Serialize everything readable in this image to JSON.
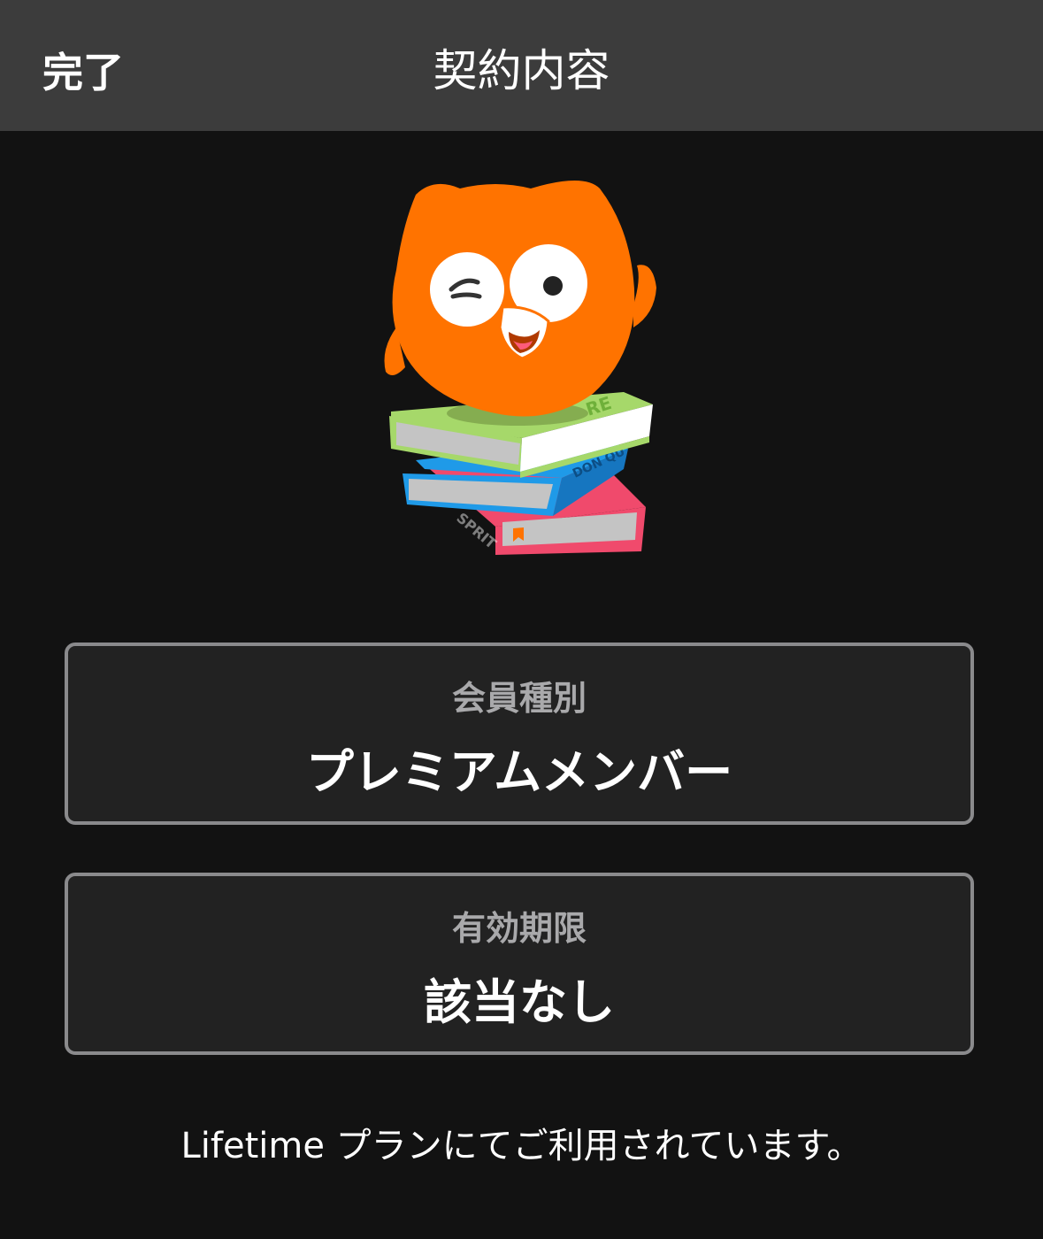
{
  "nav": {
    "done_label": "完了",
    "title": "契約内容"
  },
  "mascot": {
    "icon": "owl-on-books-icon",
    "colors": {
      "owl": "#ff7300",
      "book_top": "#a6d86a",
      "book_middle": "#1f9ae8",
      "book_bottom": "#f04a6c"
    },
    "book_spine_texts": [
      "RE",
      "DON QU",
      "SPRIT"
    ]
  },
  "membership": {
    "label": "会員種別",
    "value": "プレミアムメンバー"
  },
  "expiry": {
    "label": "有効期限",
    "value": "該当なし"
  },
  "footer": {
    "text": "Lifetime プランにてご利用されています。"
  },
  "colors": {
    "nav_bg": "#3c3c3c",
    "page_bg": "#121212",
    "card_bg": "#222222",
    "card_border": "#8a8a8c",
    "label_text": "#a9a9ab",
    "text": "#ffffff"
  }
}
